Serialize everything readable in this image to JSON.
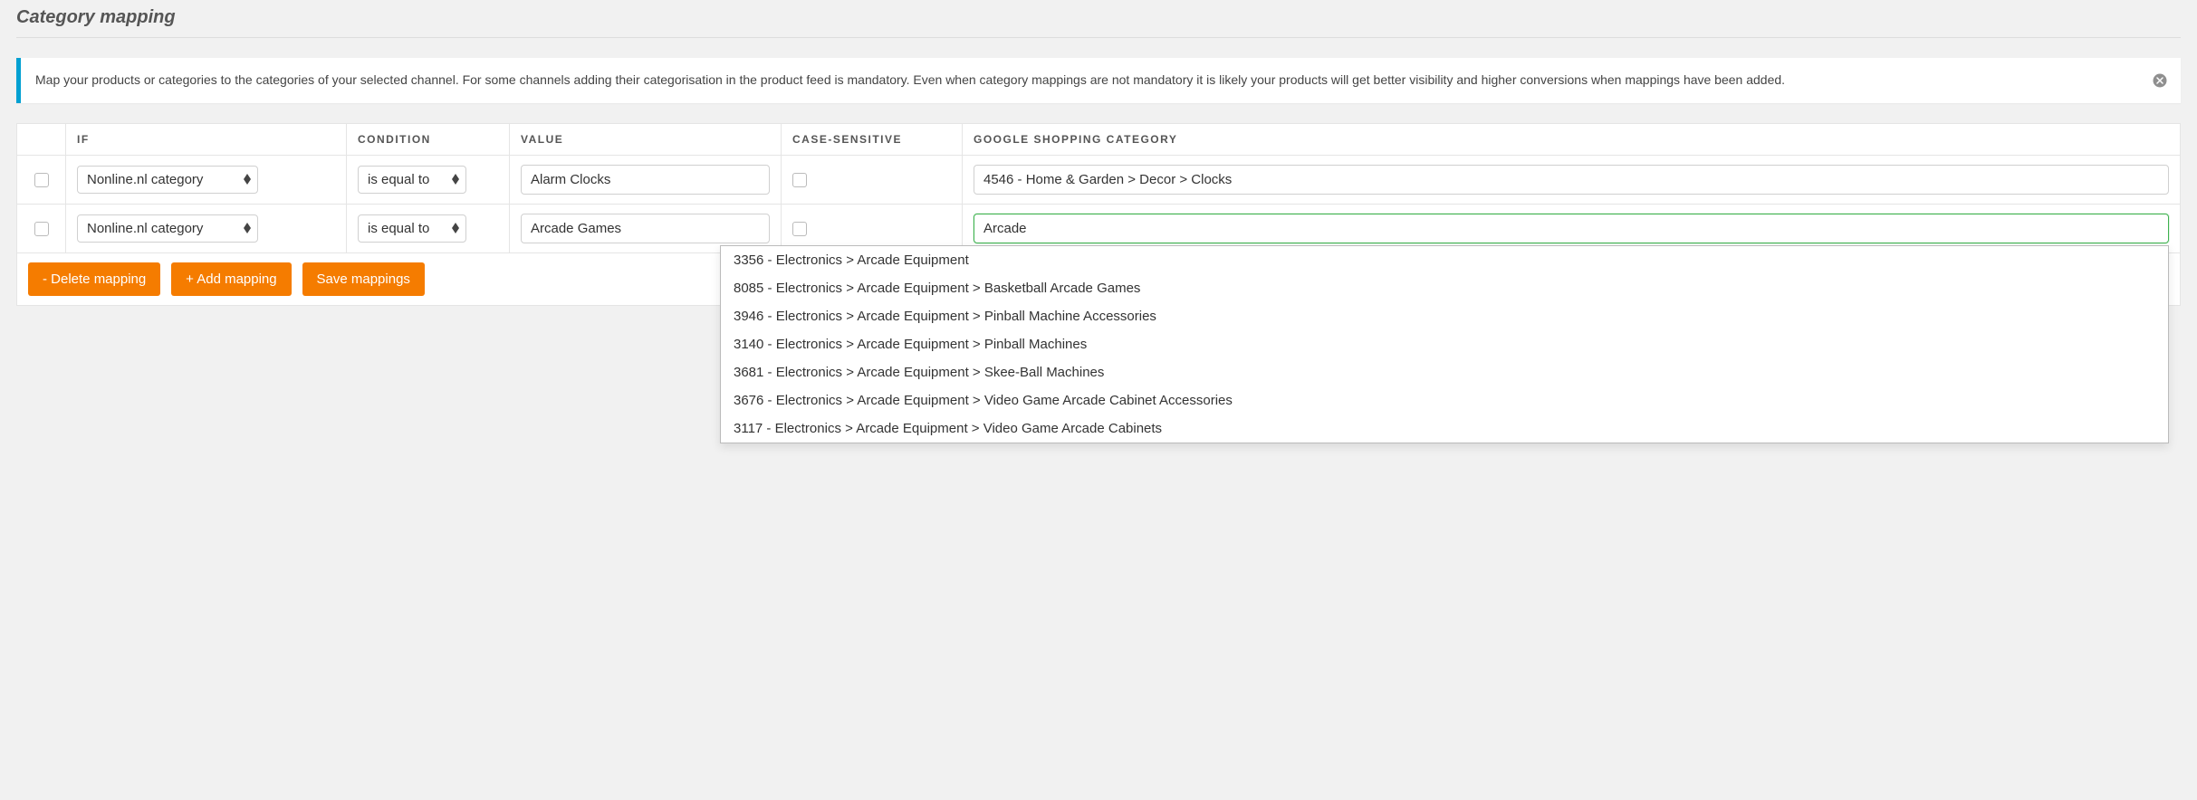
{
  "title": "Category mapping",
  "alert": {
    "text": "Map your products or categories to the categories of your selected channel. For some channels adding their categorisation in the product feed is mandatory. Even when category mappings are not mandatory it is likely your products will get better visibility and higher conversions when mappings have been added."
  },
  "headers": {
    "if": "IF",
    "condition": "CONDITION",
    "value": "VALUE",
    "case_sensitive": "CASE-SENSITIVE",
    "gsc": "GOOGLE SHOPPING CATEGORY"
  },
  "rows": [
    {
      "if_select": "Nonline.nl category",
      "condition_select": "is equal to",
      "value_input": "Alarm Clocks",
      "gsc_input": "4546 - Home & Garden > Decor > Clocks"
    },
    {
      "if_select": "Nonline.nl category",
      "condition_select": "is equal to",
      "value_input": "Arcade Games",
      "gsc_input": "Arcade"
    }
  ],
  "buttons": {
    "delete": "- Delete mapping",
    "add": "+ Add mapping",
    "save": "Save mappings"
  },
  "autocomplete": [
    "3356 - Electronics > Arcade Equipment",
    "8085 - Electronics > Arcade Equipment > Basketball Arcade Games",
    "3946 - Electronics > Arcade Equipment > Pinball Machine Accessories",
    "3140 - Electronics > Arcade Equipment > Pinball Machines",
    "3681 - Electronics > Arcade Equipment > Skee-Ball Machines",
    "3676 - Electronics > Arcade Equipment > Video Game Arcade Cabinet Accessories",
    "3117 - Electronics > Arcade Equipment > Video Game Arcade Cabinets"
  ]
}
